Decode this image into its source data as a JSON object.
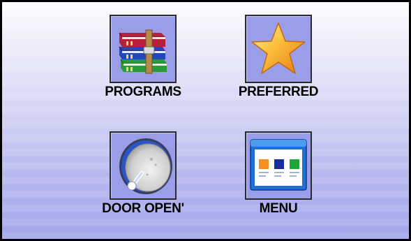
{
  "tiles": [
    {
      "label": "PROGRAMS",
      "icon": "books-icon"
    },
    {
      "label": "PREFERRED",
      "icon": "star-icon"
    },
    {
      "label": "DOOR OPEN'",
      "icon": "dial-knob-icon"
    },
    {
      "label": "MENU",
      "icon": "window-menu-icon"
    }
  ],
  "colors": {
    "background_top": "#ffffff",
    "background_bottom": "#a3a5ec",
    "icon_box": "#9a9de8",
    "border": "#000000"
  }
}
